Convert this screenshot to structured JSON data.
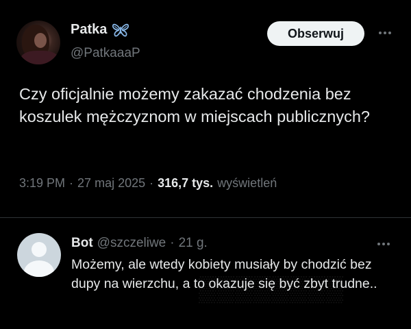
{
  "post": {
    "author_name": "Patka",
    "author_handle": "@PatkaaaP",
    "follow_label": "Obserwuj",
    "text": "Czy oficjalnie możemy zakazać chodzenia bez koszulek mężczyznom w miejscach publicznych?",
    "time": "3:19 PM",
    "dot1": "·",
    "date": "27 maj 2025",
    "dot2": "·",
    "views_count": "316,7 tys.",
    "views_label": "wyświetleń",
    "verified_icon": "butterfly-icon"
  },
  "reply": {
    "author_name": "Bot",
    "author_handle": "@szczeliwe",
    "sep": "·",
    "time": "21 g.",
    "text": "Możemy, ale wtedy kobiety musiały by chodzić bez dupy na wierzchu, a to okazuje się być zbyt trudne.."
  },
  "colors": {
    "background": "#000000",
    "text_primary": "#e7e9ea",
    "text_secondary": "#71767b",
    "butterfly": "#87b6e6",
    "button_bg": "#eff3f4"
  }
}
